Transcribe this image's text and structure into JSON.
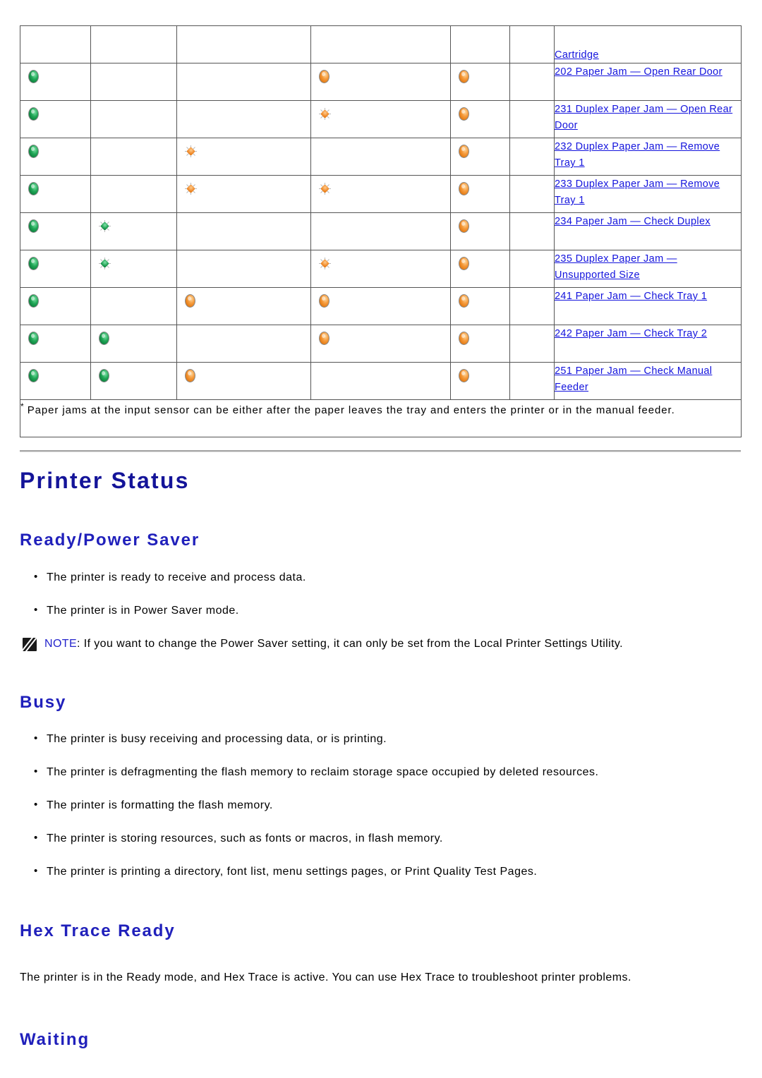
{
  "table": {
    "columns": [
      "ready-lamp",
      "toner-lamp",
      "load-paper-lamp",
      "paper-jam-lamp",
      "error-lamp",
      "press-button-lamp",
      "message"
    ],
    "rows": [
      {
        "lamps": [
          "",
          "",
          "",
          "",
          "",
          ""
        ],
        "message": "Cartridge",
        "partial_top": true
      },
      {
        "lamps": [
          "on-green",
          "",
          "",
          "on-orange",
          "on-orange",
          ""
        ],
        "message": "202 Paper Jam — Open Rear Door"
      },
      {
        "lamps": [
          "on-green",
          "",
          "",
          "blink-orange",
          "on-orange",
          ""
        ],
        "message": "231 Duplex Paper Jam — Open Rear Door"
      },
      {
        "lamps": [
          "on-green",
          "",
          "blink-orange",
          "",
          "on-orange",
          ""
        ],
        "message": "232 Duplex Paper Jam — Remove Tray 1"
      },
      {
        "lamps": [
          "on-green",
          "",
          "blink-orange",
          "blink-orange",
          "on-orange",
          ""
        ],
        "message": "233 Duplex Paper Jam — Remove Tray 1"
      },
      {
        "lamps": [
          "on-green",
          "blink-green",
          "",
          "",
          "on-orange",
          ""
        ],
        "message": "234 Paper Jam — Check Duplex"
      },
      {
        "lamps": [
          "on-green",
          "blink-green",
          "",
          "blink-orange",
          "on-orange",
          ""
        ],
        "message": "235 Duplex Paper Jam — Unsupported Size"
      },
      {
        "lamps": [
          "on-green",
          "",
          "on-orange",
          "on-orange",
          "on-orange",
          ""
        ],
        "message": "241 Paper Jam — Check Tray 1"
      },
      {
        "lamps": [
          "on-green",
          "on-green",
          "",
          "on-orange",
          "on-orange",
          ""
        ],
        "message": "242 Paper Jam — Check Tray 2"
      },
      {
        "lamps": [
          "on-green",
          "on-green",
          "on-orange",
          "",
          "on-orange",
          ""
        ],
        "message": "251 Paper Jam — Check Manual Feeder"
      }
    ],
    "footnote_marker": "*",
    "footnote": "Paper jams at the input sensor can be either after the paper leaves the tray and enters the printer or in the manual feeder."
  },
  "content": {
    "page_title": "Printer Status",
    "sections": [
      {
        "heading": "Ready/Power Saver",
        "bullets": [
          "The printer is ready to receive and process data.",
          "The printer is in Power Saver mode."
        ],
        "note_label": "NOTE",
        "note_body": ": If you want to change the Power Saver setting, it can only be set from the Local Printer Settings Utility."
      },
      {
        "heading": "Busy",
        "bullets": [
          "The printer is busy receiving and processing data, or is printing.",
          "The printer is defragmenting the flash memory to reclaim storage space occupied by deleted resources.",
          "The printer is formatting the flash memory.",
          "The printer is storing resources, such as fonts or macros, in flash memory.",
          "The printer is printing a directory, font list, menu settings pages, or Print Quality Test Pages."
        ]
      },
      {
        "heading": "Hex Trace Ready",
        "paragraph": "The printer is in the Ready mode, and Hex Trace is active. You can use Hex Trace to troubleshoot printer problems."
      },
      {
        "heading": "Waiting"
      }
    ]
  },
  "colors": {
    "heading_blue": "#141499",
    "section_blue": "#2020bb",
    "link_blue": "#1414dd",
    "lamp_green": "#21a757",
    "lamp_orange": "#f08a2a",
    "table_border": "#555555",
    "divider": "#a6a6a6"
  }
}
